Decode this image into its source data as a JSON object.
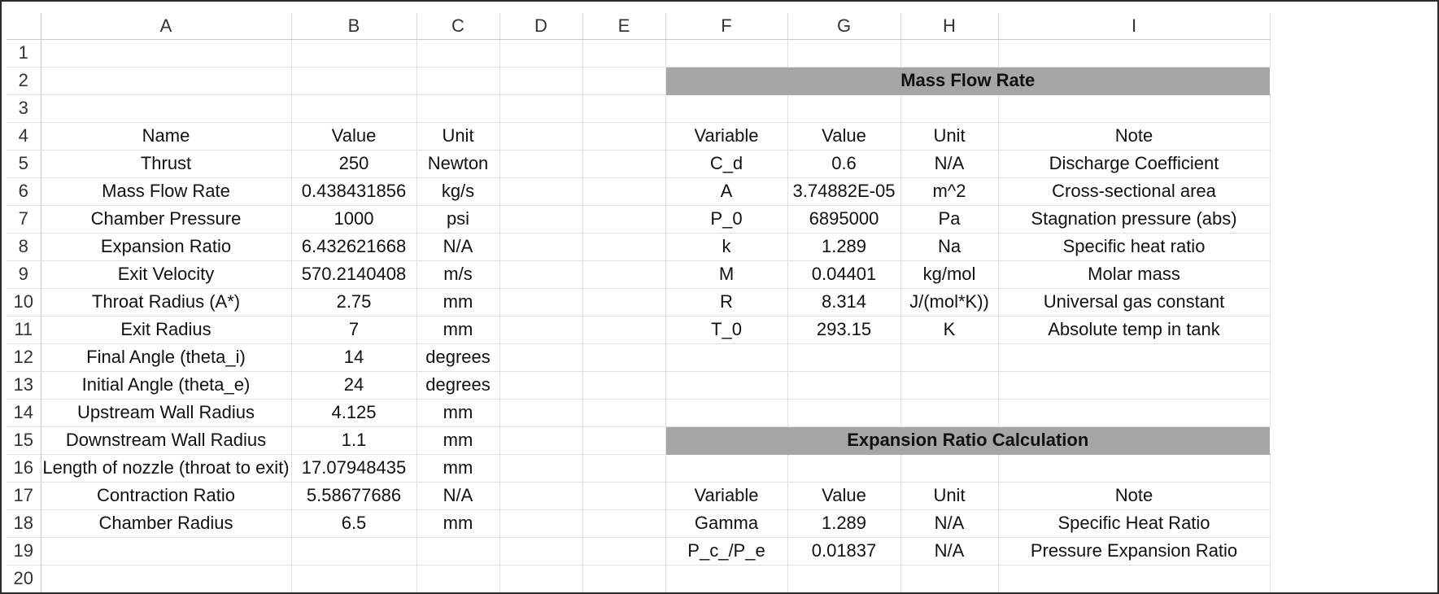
{
  "columns": [
    "A",
    "B",
    "C",
    "D",
    "E",
    "F",
    "G",
    "H",
    "I"
  ],
  "rows": [
    {
      "n": "1",
      "c": [
        "",
        "",
        "",
        "",
        "",
        "",
        "",
        "",
        ""
      ]
    },
    {
      "n": "2",
      "c": [
        "",
        "",
        "",
        "",
        "",
        "",
        "",
        "",
        ""
      ]
    },
    {
      "n": "3",
      "c": [
        "",
        "",
        "",
        "",
        "",
        "",
        "",
        "",
        ""
      ]
    },
    {
      "n": "4",
      "c": [
        "Name",
        "Value",
        "Unit",
        "",
        "",
        "Variable",
        "Value",
        "Unit",
        "Note"
      ]
    },
    {
      "n": "5",
      "c": [
        "Thrust",
        "250",
        "Newton",
        "",
        "",
        "C_d",
        "0.6",
        "N/A",
        "Discharge Coefficient"
      ]
    },
    {
      "n": "6",
      "c": [
        "Mass Flow Rate",
        "0.438431856",
        "kg/s",
        "",
        "",
        "A",
        "3.74882E-05",
        "m^2",
        "Cross-sectional area"
      ]
    },
    {
      "n": "7",
      "c": [
        "Chamber Pressure",
        "1000",
        "psi",
        "",
        "",
        "P_0",
        "6895000",
        "Pa",
        "Stagnation pressure (abs)"
      ]
    },
    {
      "n": "8",
      "c": [
        "Expansion Ratio",
        "6.432621668",
        "N/A",
        "",
        "",
        "k",
        "1.289",
        "Na",
        "Specific heat ratio"
      ]
    },
    {
      "n": "9",
      "c": [
        "Exit Velocity",
        "570.2140408",
        "m/s",
        "",
        "",
        "M",
        "0.04401",
        "kg/mol",
        "Molar mass"
      ]
    },
    {
      "n": "10",
      "c": [
        "Throat Radius (A*)",
        "2.75",
        "mm",
        "",
        "",
        "R",
        "8.314",
        "J/(mol*K))",
        "Universal gas constant"
      ]
    },
    {
      "n": "11",
      "c": [
        "Exit Radius",
        "7",
        "mm",
        "",
        "",
        "T_0",
        "293.15",
        "K",
        "Absolute temp in tank"
      ]
    },
    {
      "n": "12",
      "c": [
        "Final Angle (theta_i)",
        "14",
        "degrees",
        "",
        "",
        "",
        "",
        "",
        ""
      ]
    },
    {
      "n": "13",
      "c": [
        "Initial Angle (theta_e)",
        "24",
        "degrees",
        "",
        "",
        "",
        "",
        "",
        ""
      ]
    },
    {
      "n": "14",
      "c": [
        "Upstream Wall Radius",
        "4.125",
        "mm",
        "",
        "",
        "",
        "",
        "",
        ""
      ]
    },
    {
      "n": "15",
      "c": [
        "Downstream Wall Radius",
        "1.1",
        "mm",
        "",
        "",
        "",
        "",
        "",
        ""
      ]
    },
    {
      "n": "16",
      "c": [
        "Length of nozzle (throat to exit)",
        "17.07948435",
        "mm",
        "",
        "",
        "",
        "",
        "",
        ""
      ]
    },
    {
      "n": "17",
      "c": [
        "Contraction Ratio",
        "5.58677686",
        "N/A",
        "",
        "",
        "Variable",
        "Value",
        "Unit",
        "Note"
      ]
    },
    {
      "n": "18",
      "c": [
        "Chamber Radius",
        "6.5",
        "mm",
        "",
        "",
        "Gamma",
        "1.289",
        "N/A",
        "Specific Heat Ratio"
      ]
    },
    {
      "n": "19",
      "c": [
        "",
        "",
        "",
        "",
        "",
        "P_c_/P_e",
        "0.01837",
        "N/A",
        "Pressure Expansion Ratio"
      ]
    },
    {
      "n": "20",
      "c": [
        "",
        "",
        "",
        "",
        "",
        "",
        "",
        "",
        ""
      ]
    }
  ],
  "section_headers": [
    {
      "row": "2",
      "label": "Mass Flow Rate"
    },
    {
      "row": "15",
      "label": "Expansion Ratio Calculation"
    }
  ],
  "colors": {
    "section_header_fill": "#a6a6a6",
    "gridline": "#e1e1e1",
    "border": "#2b2b2b"
  }
}
